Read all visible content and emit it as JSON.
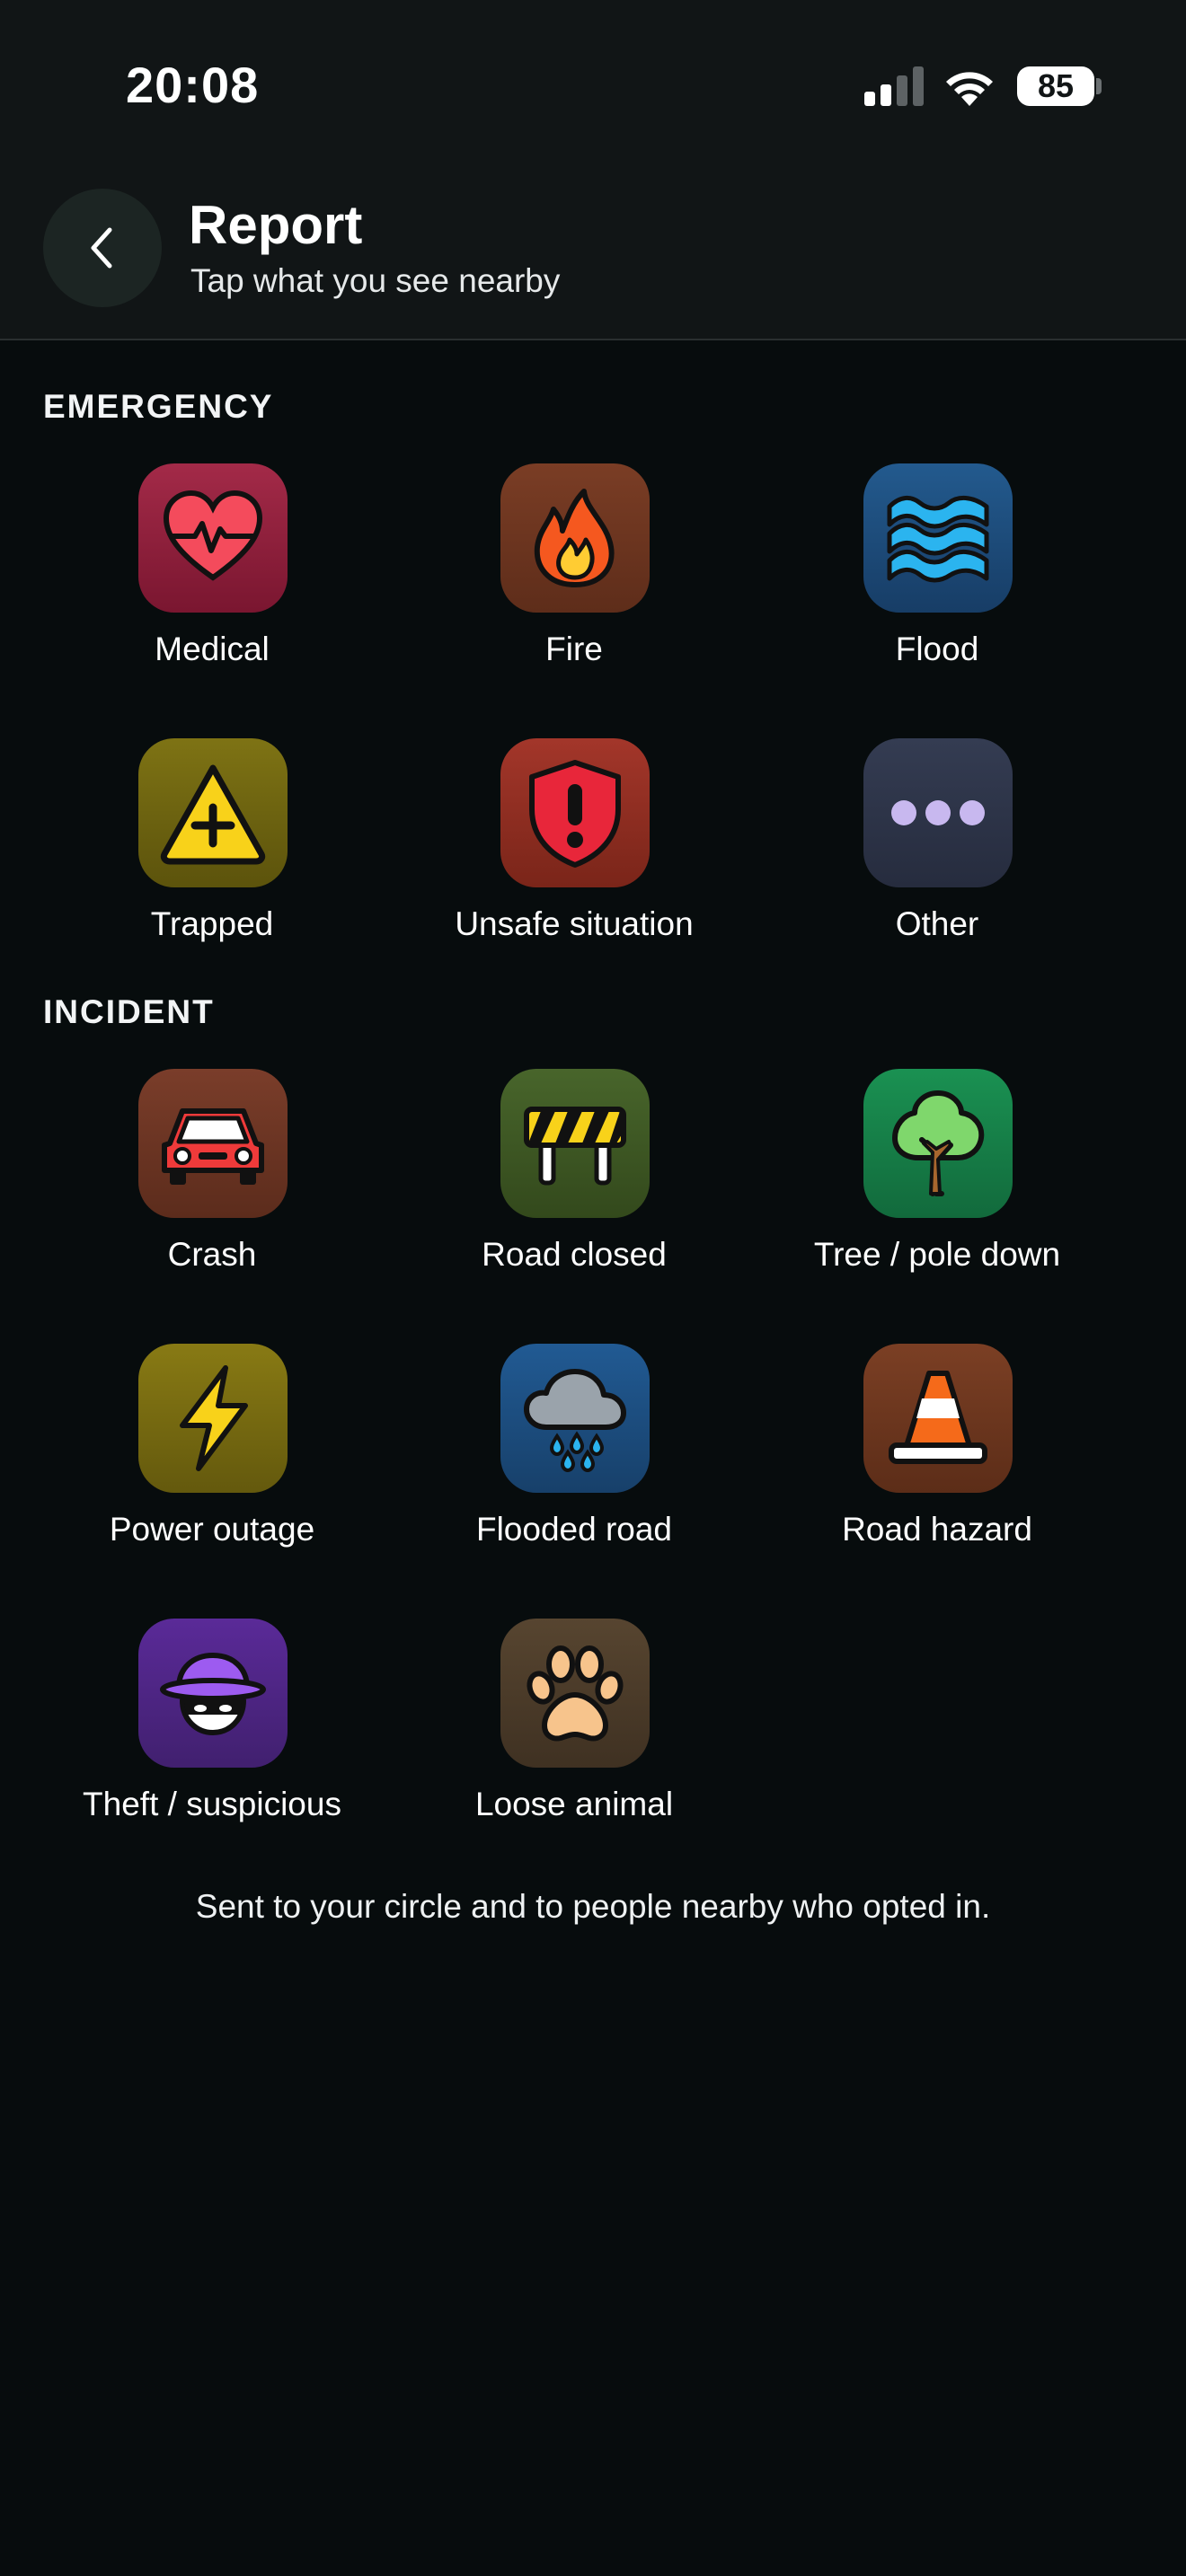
{
  "status_bar": {
    "time": "20:08",
    "battery": "85"
  },
  "header": {
    "title": "Report",
    "subtitle": "Tap what you see nearby",
    "back_icon": "chevron-left-icon"
  },
  "sections": [
    {
      "label": "EMERGENCY",
      "items": [
        {
          "label": "Medical",
          "icon": "heart-pulse-icon",
          "color": "#8e1e3a"
        },
        {
          "label": "Fire",
          "icon": "fire-icon",
          "color": "#6e3620"
        },
        {
          "label": "Flood",
          "icon": "water-waves-icon",
          "color": "#1d4a78"
        },
        {
          "label": "Trapped",
          "icon": "warning-plus-icon",
          "color": "#6e6410"
        },
        {
          "label": "Unsafe situation",
          "icon": "shield-alert-icon",
          "color": "#8e2a22"
        },
        {
          "label": "Other",
          "icon": "more-dots-icon",
          "color": "#2d3448"
        }
      ]
    },
    {
      "label": "INCIDENT",
      "items": [
        {
          "label": "Crash",
          "icon": "car-icon",
          "color": "#6a3322"
        },
        {
          "label": "Road closed",
          "icon": "road-barrier-icon",
          "color": "#3e5a24"
        },
        {
          "label": "Tree / pole down",
          "icon": "tree-icon",
          "color": "#17814a"
        },
        {
          "label": "Power outage",
          "icon": "lightning-icon",
          "color": "#7a6c10"
        },
        {
          "label": "Flooded road",
          "icon": "rain-cloud-icon",
          "color": "#1b4b7d"
        },
        {
          "label": "Road hazard",
          "icon": "traffic-cone-icon",
          "color": "#6a3420"
        },
        {
          "label": "Theft / suspicious",
          "icon": "burglar-icon",
          "color": "#4e2486"
        },
        {
          "label": "Loose animal",
          "icon": "paw-icon",
          "color": "#4c3c28"
        }
      ]
    }
  ],
  "footer_note": "Sent to your circle and to people nearby who opted in."
}
